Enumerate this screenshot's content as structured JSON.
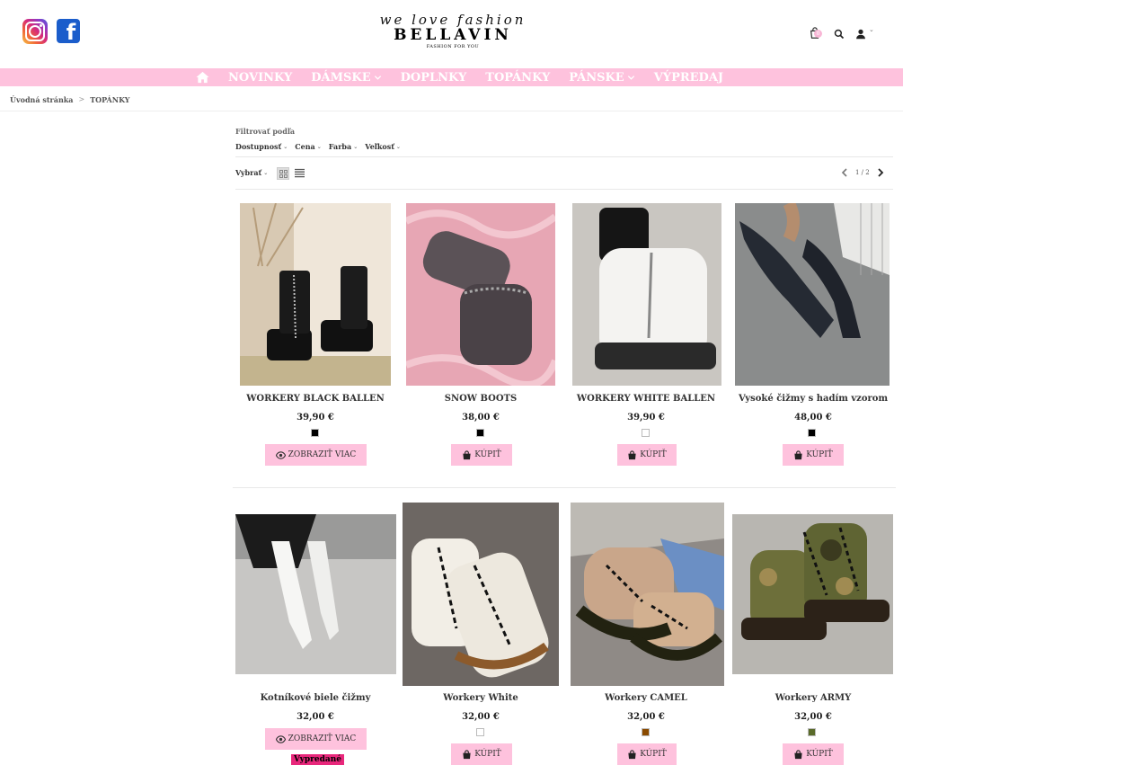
{
  "header": {
    "logo_script": "we love fashion",
    "logo_main": "BELLAVIN",
    "logo_sub": "FASHION FOR YOU",
    "cart_count": "0",
    "social": [
      "instagram-icon",
      "facebook-icon"
    ],
    "facebook_letter": "f"
  },
  "nav": {
    "items": [
      {
        "label": "NOVINKY",
        "dropdown": false
      },
      {
        "label": "DÁMSKE",
        "dropdown": true
      },
      {
        "label": "DOPLNKY",
        "dropdown": false
      },
      {
        "label": "TOPÁNKY",
        "dropdown": false
      },
      {
        "label": "PÁNSKE",
        "dropdown": true
      },
      {
        "label": "VÝPREDAJ",
        "dropdown": false
      }
    ],
    "bg_color": "#fec2dd"
  },
  "breadcrumb": {
    "home": "Úvodná stránka",
    "separator": ">",
    "current": "TOPÁNKY"
  },
  "filters": {
    "title": "Filtrovať podľa",
    "items": [
      "Dostupnosť",
      "Cena",
      "Farba",
      "Veľkosť"
    ]
  },
  "toolbar": {
    "sort_label": "Vybrať",
    "pagination": "1 / 2"
  },
  "buttons": {
    "buy": "KÚPIŤ",
    "view_more": "ZOBRAZIŤ VIAC",
    "sold_out": "Vypredané"
  },
  "products": [
    {
      "name": "WORKERY BLACK BALLEN",
      "price": "39,90 €",
      "color": "#000000",
      "action": "view_more"
    },
    {
      "name": "SNOW BOOTS",
      "price": "38,00 €",
      "color": "#000000",
      "action": "buy"
    },
    {
      "name": "WORKERY WHITE BALLEN",
      "price": "39,90 €",
      "color": "#ffffff",
      "action": "buy"
    },
    {
      "name": "Vysoké čižmy s hadím vzorom",
      "price": "48,00 €",
      "color": "#000000",
      "action": "buy"
    },
    {
      "name": "Kotníkové biele čižmy",
      "price": "32,00 €",
      "color": null,
      "action": "view_more",
      "sold_out": true
    },
    {
      "name": "Workery White",
      "price": "32,00 €",
      "color": "#ffffff",
      "action": "buy"
    },
    {
      "name": "Workery CAMEL",
      "price": "32,00 €",
      "color": "#8a4a00",
      "action": "buy"
    },
    {
      "name": "Workery ARMY",
      "price": "32,00 €",
      "color": "#5a6b2a",
      "action": "buy"
    }
  ]
}
